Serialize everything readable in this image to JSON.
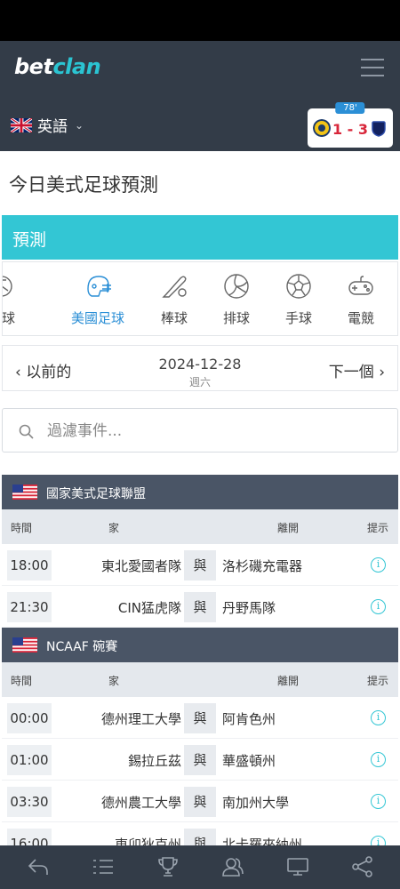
{
  "brand": {
    "part1": "bet",
    "part2": "clan"
  },
  "language": {
    "label": "英語"
  },
  "live_score": {
    "minute": "78'",
    "score": "1 - 3"
  },
  "page_title": "今日美式足球預測",
  "panel_title": "預測",
  "sports": [
    {
      "label": "棍球",
      "icon": "hockey-icon",
      "active": false
    },
    {
      "label": "美國足球",
      "icon": "football-helmet-icon",
      "active": true
    },
    {
      "label": "棒球",
      "icon": "baseball-icon",
      "active": false
    },
    {
      "label": "排球",
      "icon": "volleyball-icon",
      "active": false
    },
    {
      "label": "手球",
      "icon": "handball-icon",
      "active": false
    },
    {
      "label": "電競",
      "icon": "gamepad-icon",
      "active": false
    }
  ],
  "date_nav": {
    "prev": "以前的",
    "next": "下一個",
    "date": "2024-12-28",
    "weekday": "週六"
  },
  "search": {
    "placeholder": "過濾事件..."
  },
  "columns": {
    "time": "時間",
    "home": "家",
    "away": "離開",
    "tip": "提示"
  },
  "vs_label": "與",
  "leagues": [
    {
      "name": "國家美式足球聯盟",
      "matches": [
        {
          "time": "18:00",
          "home": "東北愛國者隊",
          "away": "洛杉磯充電器"
        },
        {
          "time": "21:30",
          "home": "CIN猛虎隊",
          "away": "丹野馬隊"
        }
      ]
    },
    {
      "name": "NCAAF 碗賽",
      "matches": [
        {
          "time": "00:00",
          "home": "德州理工大學",
          "away": "阿肯色州"
        },
        {
          "time": "01:00",
          "home": "錫拉丘茲",
          "away": "華盛頓州"
        },
        {
          "time": "03:30",
          "home": "德州農工大學",
          "away": "南加州大學"
        },
        {
          "time": "16:00",
          "home": "東卯狄克州",
          "away": "北卡羅來納州"
        }
      ]
    }
  ],
  "bottom_nav": [
    "back-icon",
    "list-icon",
    "trophy-icon",
    "users-icon",
    "monitor-icon",
    "share-icon"
  ],
  "colors": {
    "header_bg": "#333c48",
    "accent": "#33c6d4",
    "league_bg": "#4a5566",
    "live_score": "#d8263a",
    "minute_badge": "#2b8fd6"
  }
}
